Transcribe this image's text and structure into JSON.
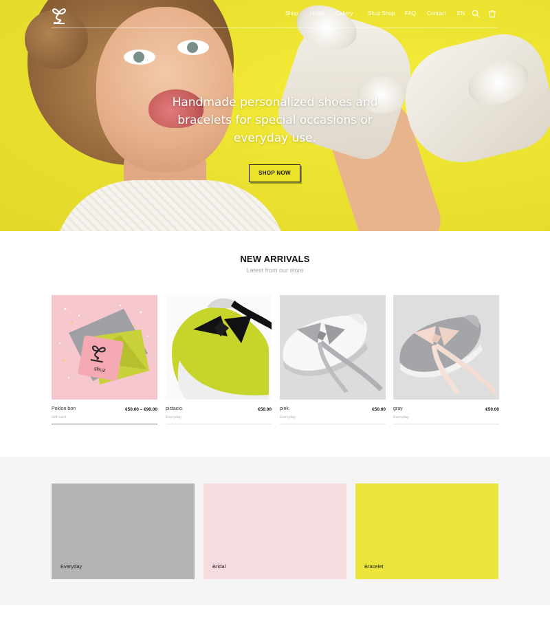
{
  "nav": {
    "items": [
      "Shop",
      "Home",
      "Gallery",
      "Shuz Shop",
      "FAQ",
      "Contact",
      "EN"
    ],
    "cart_count": "0"
  },
  "hero": {
    "headline": "Handmade personalized shoes and bracelets for special occasions or everyday use.",
    "cta_label": "SHOP NOW"
  },
  "new_arrivals": {
    "title": "NEW ARRIVALS",
    "subtitle": "Latest from our store",
    "products": [
      {
        "name": "Poklon bon",
        "price": "€50.00 – €90.00",
        "category": "Gift card"
      },
      {
        "name": "pistacio.",
        "price": "€50.00",
        "category": "Everyday"
      },
      {
        "name": "pink.",
        "price": "€50.00",
        "category": "Everyday"
      },
      {
        "name": "gray",
        "price": "€50.00",
        "category": "Everyday"
      }
    ]
  },
  "categories": [
    {
      "label": "Everyday",
      "color": "#b3b3b3"
    },
    {
      "label": "Bridal",
      "color": "#f5dcdf"
    },
    {
      "label": "Bracelet",
      "color": "#ebe43a"
    }
  ],
  "colors": {
    "accent_yellow": "#ece22a",
    "text_dark": "#111111",
    "muted": "#aaaaaa"
  },
  "gift_card_text": "shuz"
}
